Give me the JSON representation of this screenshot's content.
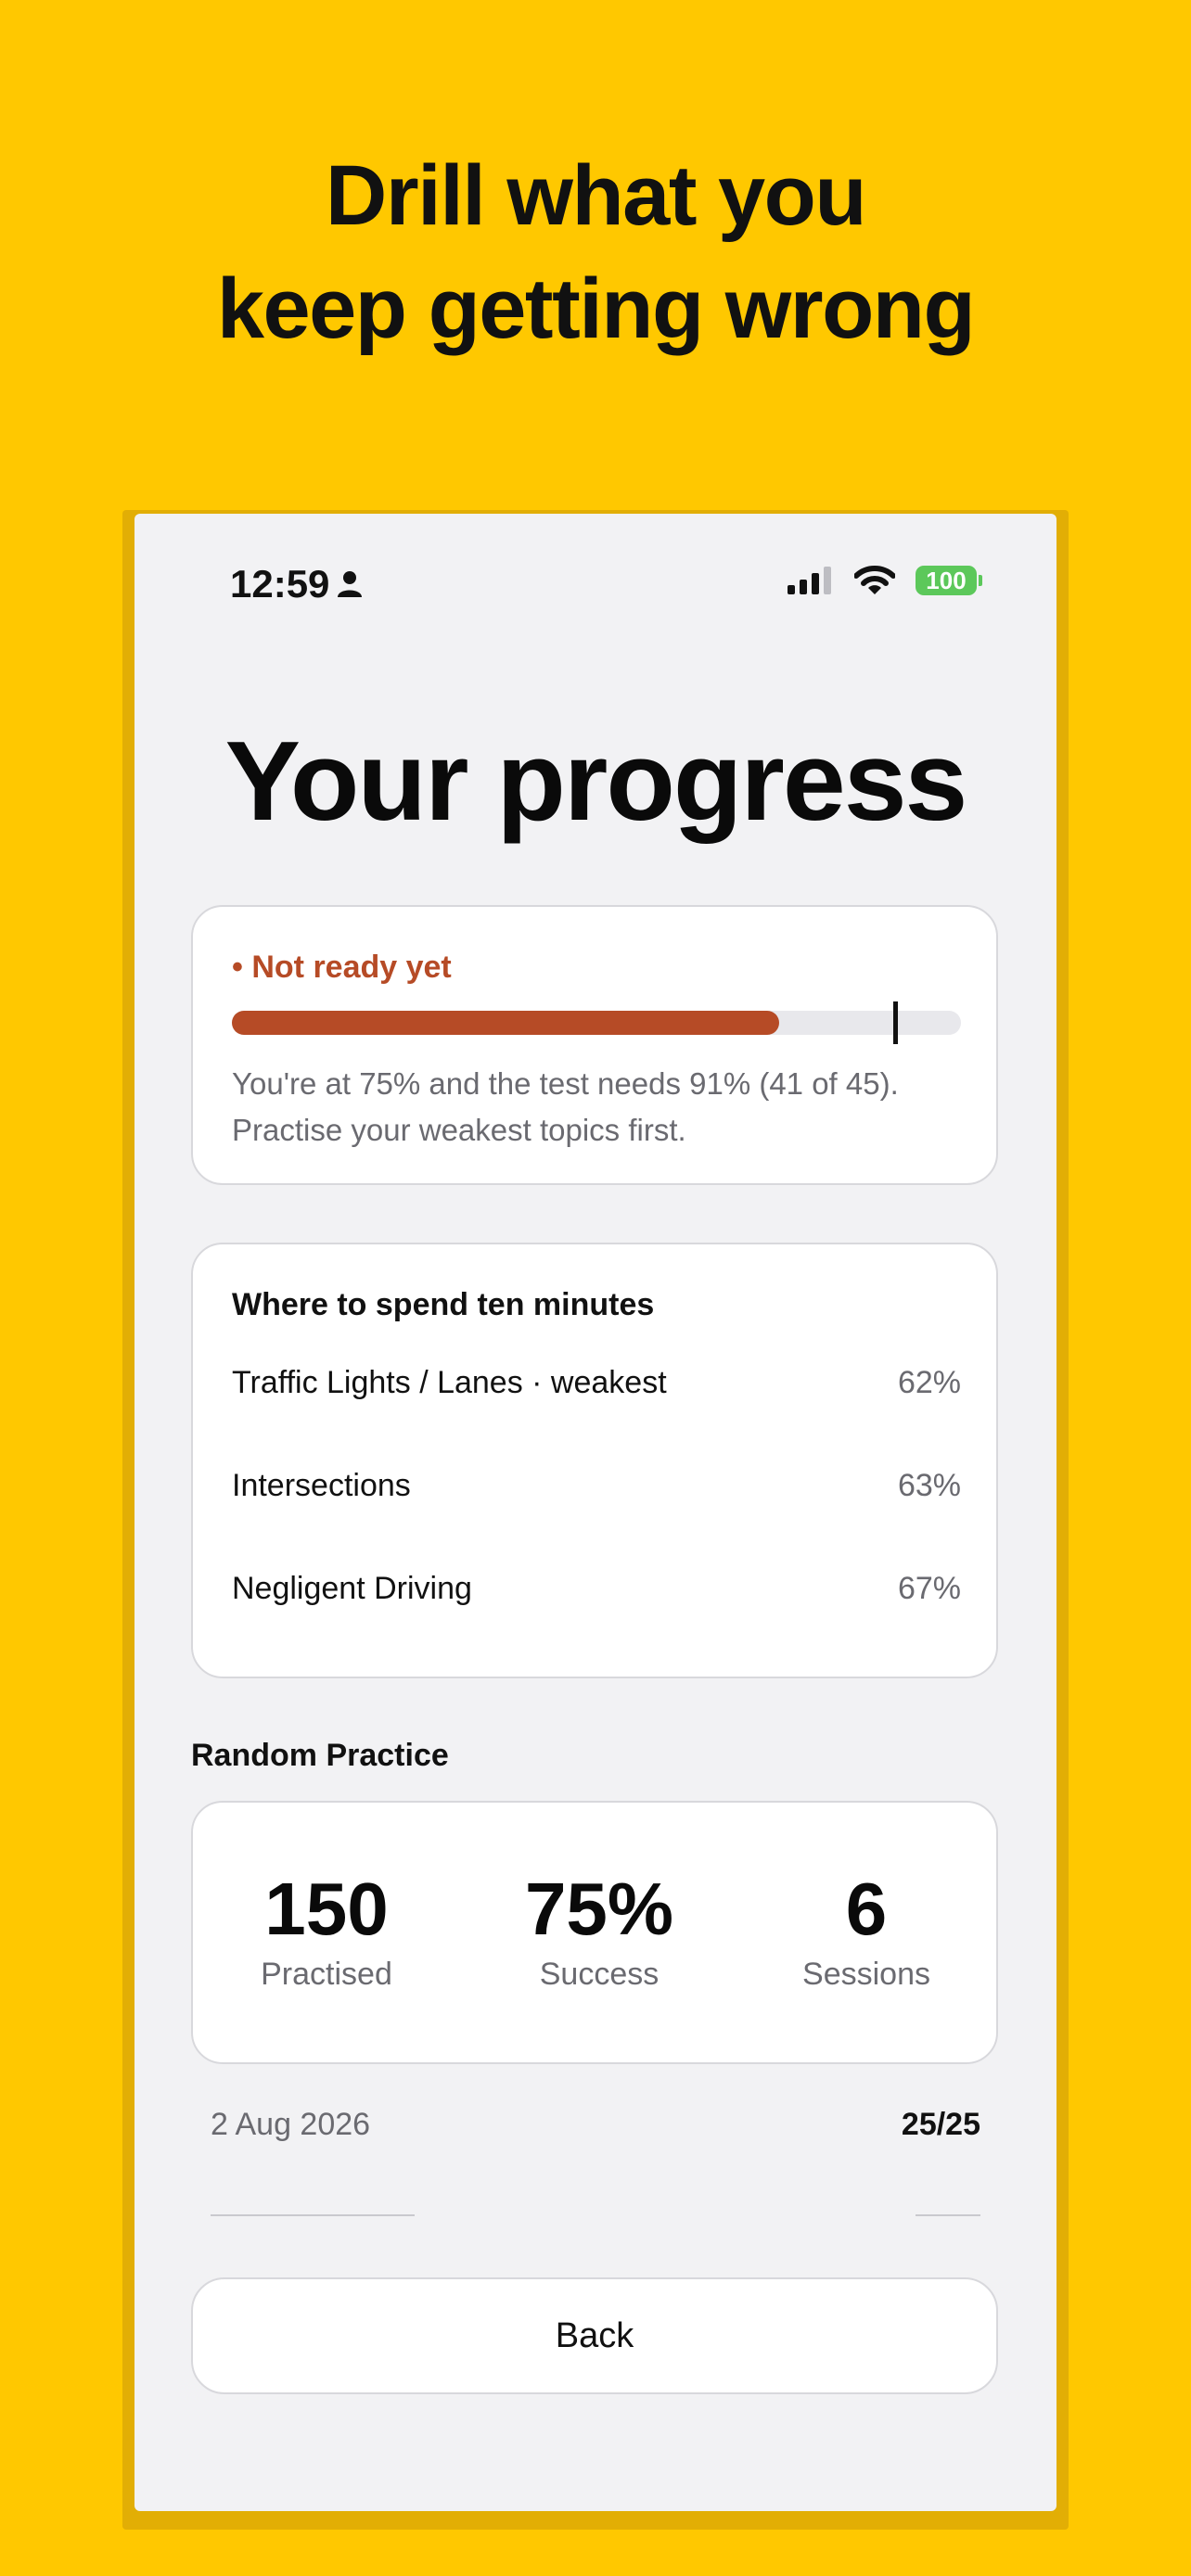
{
  "headline": [
    "Drill what you",
    "keep getting wrong"
  ],
  "status_bar": {
    "time": "12:59",
    "battery": "100"
  },
  "page_title": "Your progress",
  "readiness": {
    "label": "• Not ready yet",
    "current_percent": 75,
    "target_percent": 91,
    "description": "You're at 75% and the test needs 91% (41 of 45). Practise your weakest topics first."
  },
  "focus": {
    "title": "Where to spend ten minutes",
    "items": [
      {
        "name": "Traffic Lights / Lanes · weakest",
        "percent": "62%"
      },
      {
        "name": "Intersections",
        "percent": "63%"
      },
      {
        "name": "Negligent Driving",
        "percent": "67%"
      }
    ]
  },
  "random_practice": {
    "title": "Random Practice",
    "stats": [
      {
        "value": "150",
        "label": "Practised"
      },
      {
        "value": "75%",
        "label": "Success"
      },
      {
        "value": "6",
        "label": "Sessions"
      }
    ],
    "sessions": [
      {
        "date": "2 Aug 2026",
        "score": "25/25"
      }
    ]
  },
  "back_label": "Back",
  "colors": {
    "background": "#FFC800",
    "accent": "#B64B26",
    "battery": "#5CC85A"
  }
}
